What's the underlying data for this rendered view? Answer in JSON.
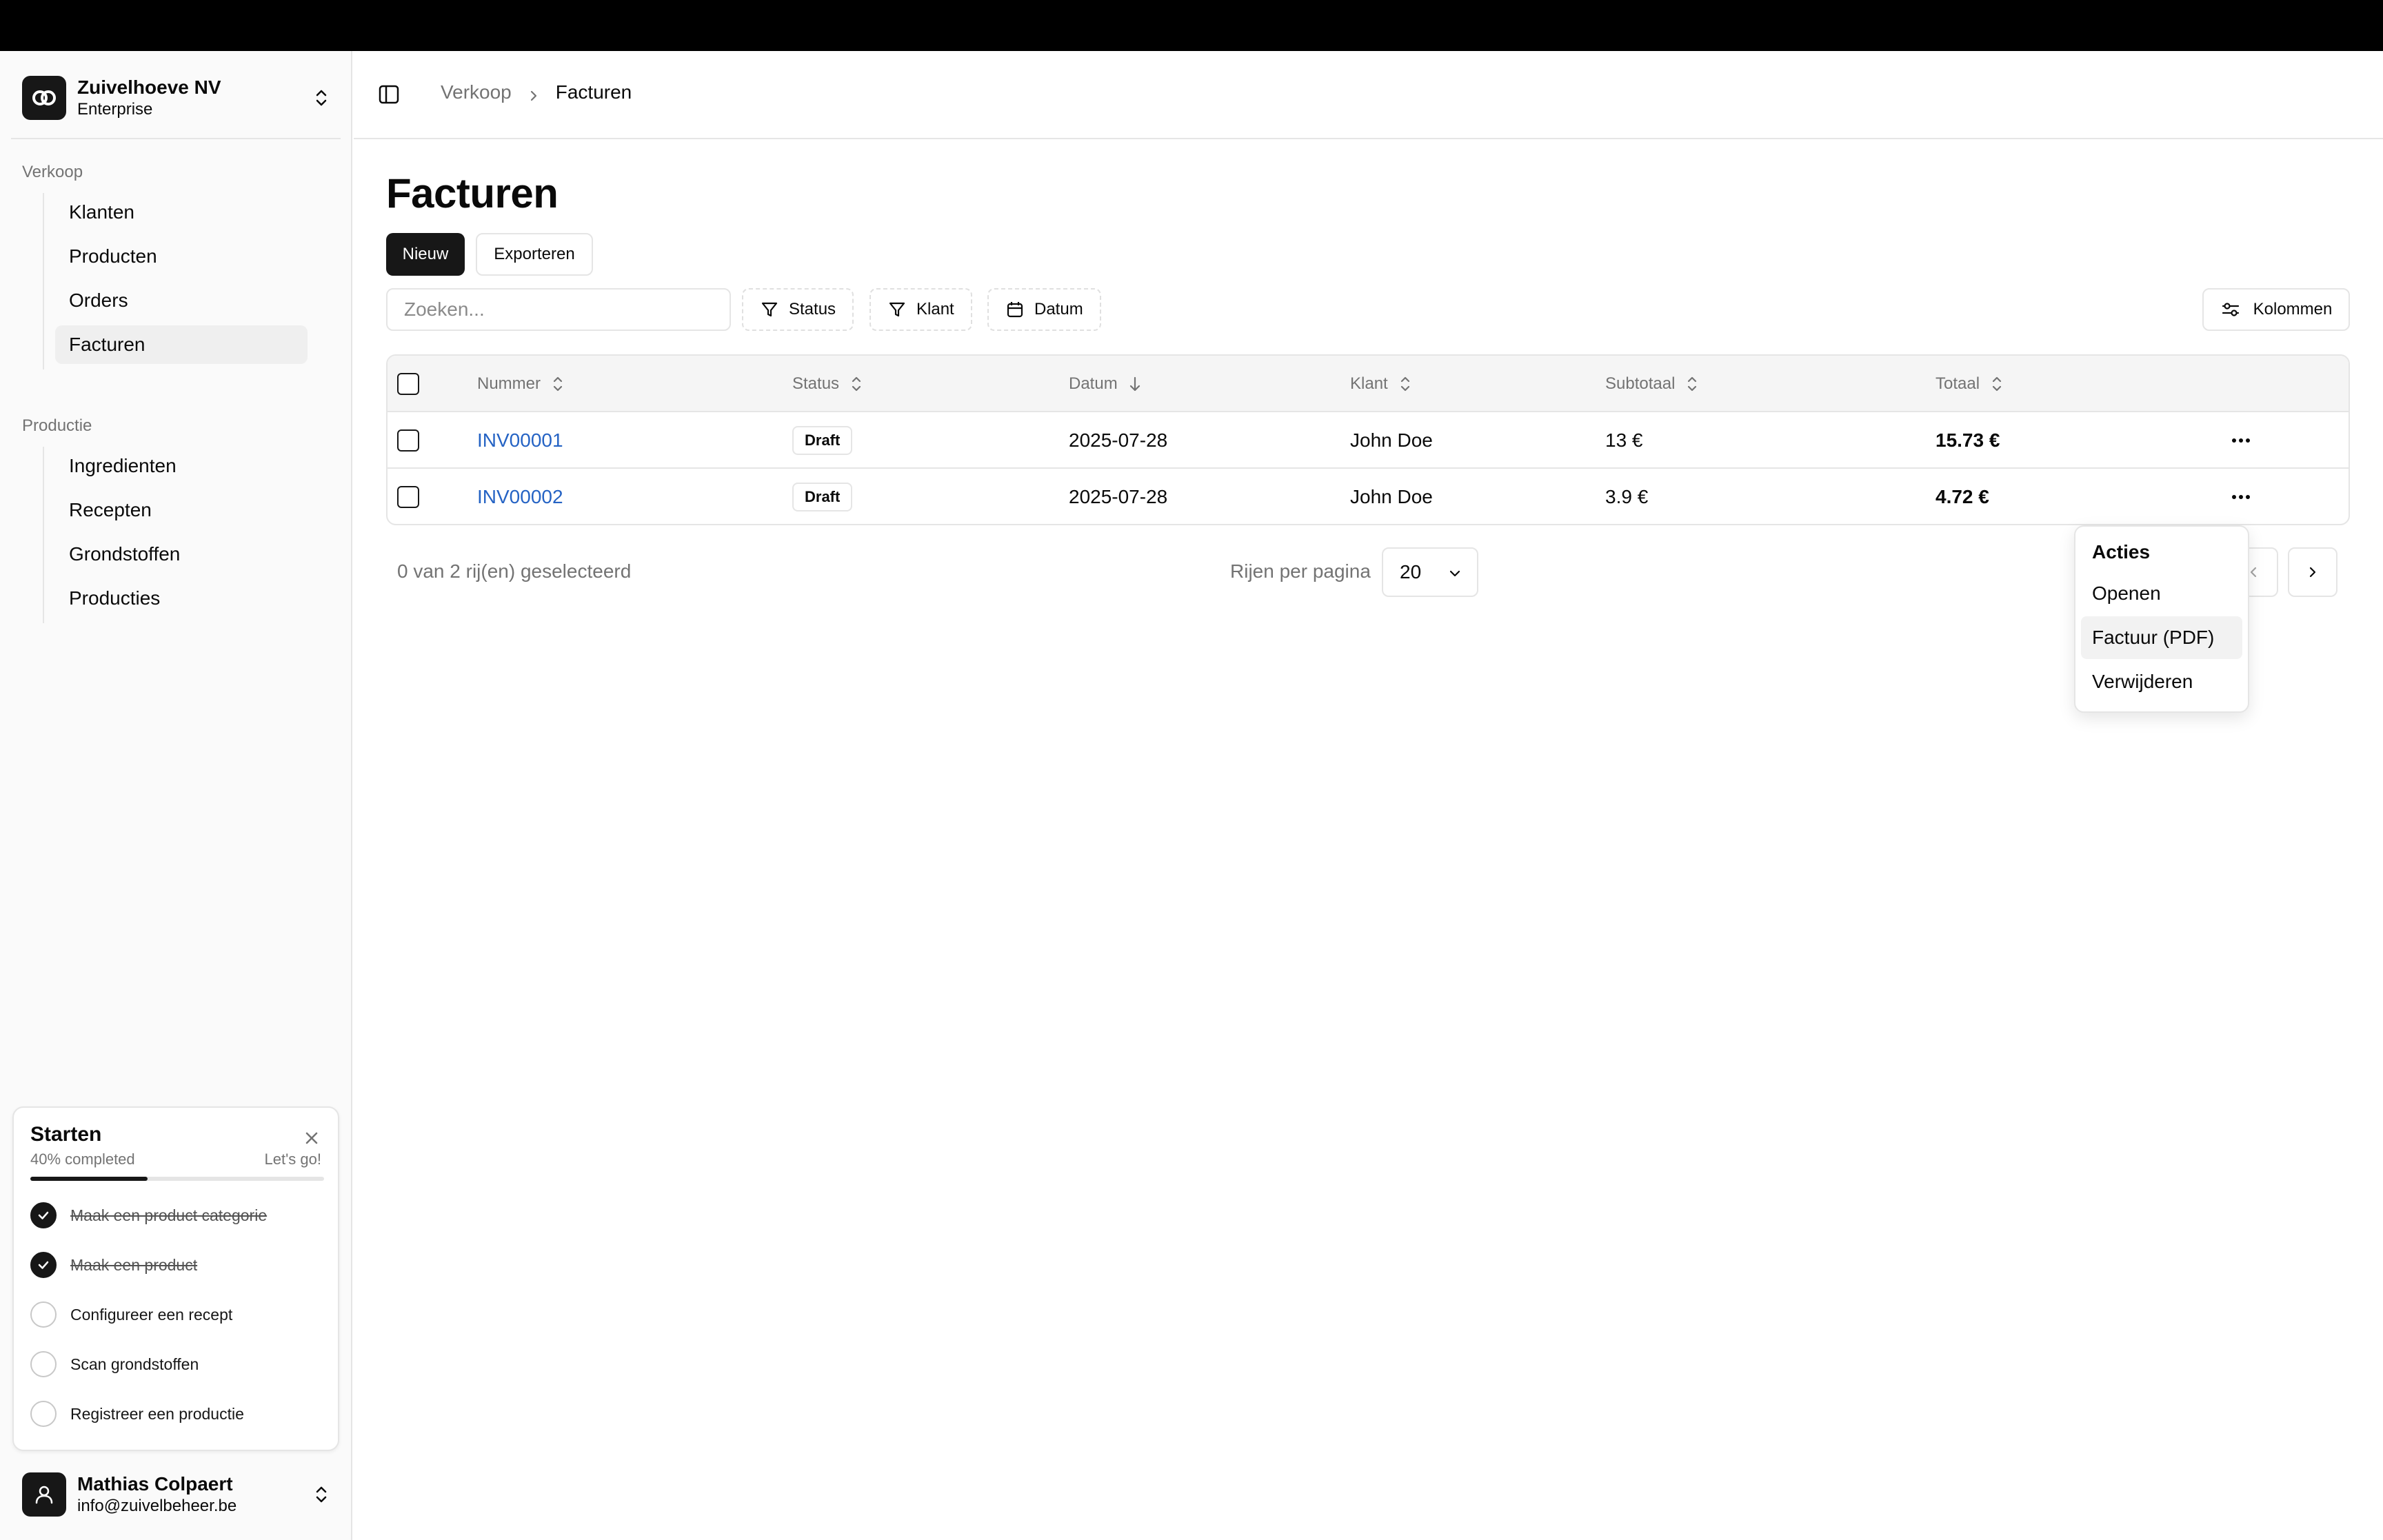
{
  "org": {
    "name": "Zuivelhoeve NV",
    "plan": "Enterprise"
  },
  "sidebar": {
    "groups": [
      {
        "label": "Verkoop",
        "items": [
          "Klanten",
          "Producten",
          "Orders",
          "Facturen"
        ],
        "active": "Facturen"
      },
      {
        "label": "Productie",
        "items": [
          "Ingredienten",
          "Recepten",
          "Grondstoffen",
          "Producties"
        ]
      }
    ]
  },
  "onboarding": {
    "title": "Starten",
    "progress_label": "40% completed",
    "progress": 0.4,
    "cta": "Let's go!",
    "tasks": [
      {
        "label": "Maak een product categorie",
        "done": true
      },
      {
        "label": "Maak een product",
        "done": true
      },
      {
        "label": "Configureer een recept",
        "done": false
      },
      {
        "label": "Scan grondstoffen",
        "done": false
      },
      {
        "label": "Registreer een productie",
        "done": false
      }
    ]
  },
  "user": {
    "name": "Mathias Colpaert",
    "email": "info@zuivelbeheer.be"
  },
  "breadcrumb": {
    "parent": "Verkoop",
    "current": "Facturen"
  },
  "page": {
    "title": "Facturen",
    "new_label": "Nieuw",
    "export_label": "Exporteren"
  },
  "toolbar": {
    "search_placeholder": "Zoeken...",
    "filters": [
      "Status",
      "Klant",
      "Datum"
    ],
    "columns_label": "Kolommen"
  },
  "table": {
    "columns": [
      "Nummer",
      "Status",
      "Datum",
      "Klant",
      "Subtotaal",
      "Totaal"
    ],
    "rows": [
      {
        "nummer": "INV00001",
        "status": "Draft",
        "datum": "2025-07-28",
        "klant": "John Doe",
        "subtotaal": "13 €",
        "totaal": "15.73 €"
      },
      {
        "nummer": "INV00002",
        "status": "Draft",
        "datum": "2025-07-28",
        "klant": "John Doe",
        "subtotaal": "3.9 €",
        "totaal": "4.72 €"
      }
    ]
  },
  "footer": {
    "selected": "0 van 2 rij(en) geselecteerd",
    "rows_per_page_label": "Rijen per pagina",
    "rows_per_page": "20"
  },
  "menu": {
    "label": "Acties",
    "items": [
      "Openen",
      "Factuur (PDF)",
      "Verwijderen"
    ]
  },
  "colors": {
    "primary": "#171717",
    "link": "#2563c4",
    "muted": "#737373",
    "border": "#e5e5e5"
  },
  "icons": {
    "org_logo": "linked-rings-icon",
    "sidebar_toggle": "sidebar-panel-icon",
    "filter": "funnel-icon",
    "date": "calendar-icon",
    "columns": "sliders-icon",
    "sort": "sort-icon",
    "actions": "more-horizontal-icon"
  }
}
